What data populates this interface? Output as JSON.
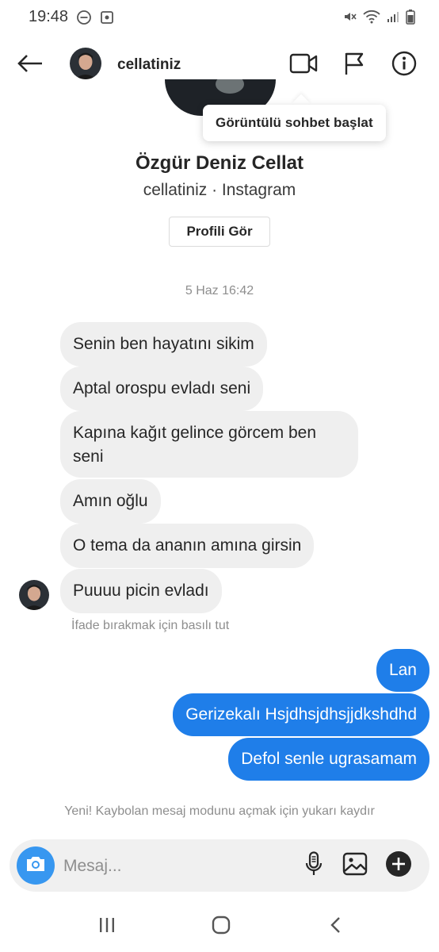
{
  "status_bar": {
    "time": "19:48",
    "icons": [
      "dnd-icon",
      "screenshot-icon",
      "mute-icon",
      "wifi-icon",
      "signal-icon",
      "battery-icon"
    ]
  },
  "header": {
    "username": "cellatiniz",
    "icons": [
      "back-arrow-icon",
      "video-call-icon",
      "flag-icon",
      "info-icon"
    ]
  },
  "tooltip": {
    "text": "Görüntülü sohbet başlat"
  },
  "profile": {
    "full_name": "Özgür Deniz Cellat",
    "subtitle": "cellatiniz · Instagram",
    "view_profile_label": "Profili Gör"
  },
  "conversation": {
    "timestamp": "5 Haz 16:42",
    "incoming": [
      "Senin ben hayatını sikim",
      "Aptal orospu evladı seni",
      "Kapına kağıt gelince görcem ben seni",
      "Amın oğlu",
      "O tema da ananın amına girsin",
      "Puuuu picin evladı"
    ],
    "reaction_hint": "İfade bırakmak için basılı tut",
    "outgoing": [
      "Lan",
      "Gerizekalı Hsjdhsjdhsjjdkshdhd",
      "Defol senle ugrasamam"
    ],
    "vanish_hint": "Yeni! Kaybolan mesaj modunu açmak için yukarı kaydır"
  },
  "composer": {
    "placeholder": "Mesaj...",
    "value": "",
    "icons": [
      "camera-icon",
      "microphone-icon",
      "gallery-icon",
      "add-icon"
    ]
  },
  "colors": {
    "outgoing_bubble": "#1f7ee9",
    "incoming_bubble": "#efefef",
    "camera_button": "#3797f0"
  }
}
